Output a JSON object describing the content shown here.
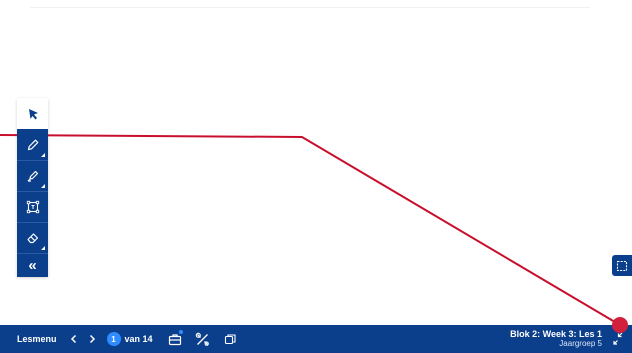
{
  "colors": {
    "brand_blue": "#0b3f8c",
    "accent_blue": "#2f8cff",
    "annotation_red": "#c8102e"
  },
  "toolbar": {
    "tools": [
      {
        "name": "select-tool",
        "icon": "cursor-arrow-icon"
      },
      {
        "name": "pen-tool",
        "icon": "pencil-icon"
      },
      {
        "name": "highlighter-tool",
        "icon": "highlighter-icon"
      },
      {
        "name": "text-box-tool",
        "icon": "text-box-icon"
      },
      {
        "name": "eraser-tool",
        "icon": "eraser-icon"
      }
    ],
    "collapse_label": "«"
  },
  "bottom_bar": {
    "lesmenu_label": "Lesmenu",
    "current_page": "1",
    "page_total_label": "van 14",
    "lesson_title": "Blok 2: Week 3: Les 1",
    "lesson_subtitle": "Jaargroep 5"
  }
}
